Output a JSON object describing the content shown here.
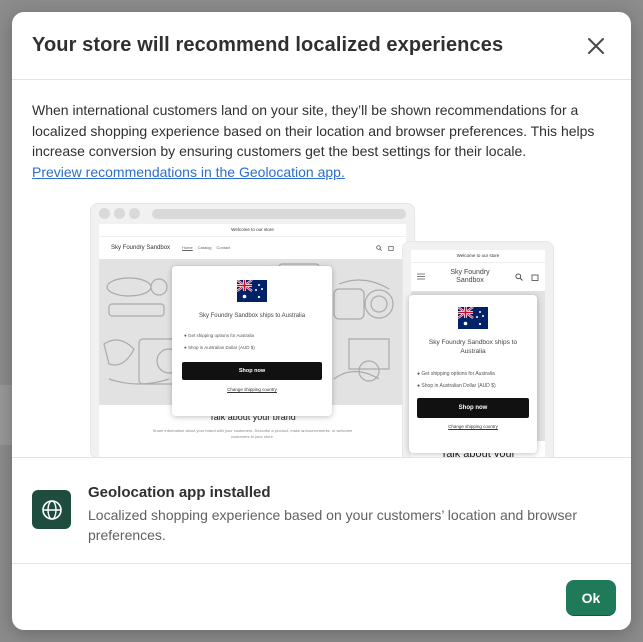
{
  "modal": {
    "title": "Your store will recommend localized experiences",
    "description": "When international customers land on your site, they’ll be shown recommendations for a localized shopping experience based on their location and browser preferences. This helps increase conversion by ensuring customers get the best settings for their locale.",
    "link_text": "Preview recommendations in the Geolocation app.",
    "ok_label": "Ok"
  },
  "illustration": {
    "announcement": "Welcome to our store",
    "store_name": "Sky Foundry Sandbox",
    "nav_links": [
      "Home",
      "Catalog",
      "Contact"
    ],
    "popup_title": "Sky Foundry Sandbox ships to Australia",
    "popup_items": [
      "Get shipping options for Australia",
      "Shop in Australian Dollar (AUD $)"
    ],
    "shop_now": "Shop now",
    "change_country": "Change shipping country",
    "talk_heading": "Talk about your brand",
    "talk_text": "Share information about your brand with your customers. Describe a product, make announcements, or welcome customers to your store.",
    "mobile_talk_heading": "Talk about your"
  },
  "app_section": {
    "icon": "globe-icon",
    "title": "Geolocation app installed",
    "description": "Localized shopping experience based on your customers’ location and browser preferences."
  },
  "colors": {
    "primary_button": "#1f7a5a",
    "link": "#2c6ecb",
    "app_icon_bg": "#1e4d3f"
  }
}
